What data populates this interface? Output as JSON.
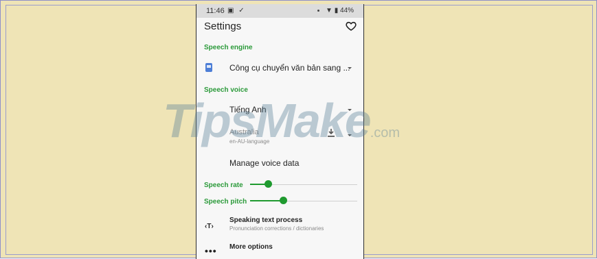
{
  "status_bar": {
    "time": "11:46",
    "icons_left": "▣ ✓",
    "battery": "44%"
  },
  "app": {
    "title": "Settings"
  },
  "sections": {
    "speech_engine": "Speech engine",
    "speech_voice": "Speech voice"
  },
  "engine": {
    "value": "Công cụ chuyển văn bản sang ..."
  },
  "voice": {
    "language": "Tiếng Anh",
    "variant": "Australia",
    "variant_sub": "en-AU-language",
    "manage": "Manage voice data"
  },
  "sliders": {
    "rate_label": "Speech rate",
    "rate_value": 0.17,
    "pitch_label": "Speech pitch",
    "pitch_value": 0.31
  },
  "rows": {
    "speaking_title": "Speaking text process",
    "speaking_sub": "Pronunciation corrections / dictionaries",
    "more_options": "More options"
  },
  "icons": {
    "favorite": "heart-icon",
    "download": "download-icon",
    "text_process": "text-process-icon",
    "more": "more-horiz-icon"
  },
  "watermark": {
    "brand": "TipsMake",
    "suffix": ".com"
  },
  "colors": {
    "accent_green": "#2b9a3a",
    "background": "#efe4b6"
  }
}
